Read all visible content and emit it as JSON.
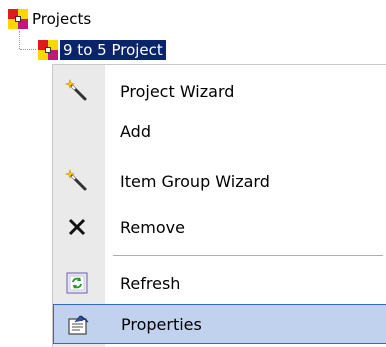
{
  "tree": {
    "root_label": "Projects",
    "child_label": "9 to 5 Project"
  },
  "menu": {
    "items": [
      {
        "label": "Project Wizard",
        "icon": "magic-wand-icon"
      },
      {
        "label": "Add",
        "icon": ""
      },
      {
        "label": "Item Group Wizard",
        "icon": "magic-wand-icon"
      },
      {
        "label": "Remove",
        "icon": "close-icon"
      },
      {
        "label": "Refresh",
        "icon": "refresh-icon"
      },
      {
        "label": "Properties",
        "icon": "properties-icon"
      }
    ]
  },
  "colors": {
    "selection": "#0a246a",
    "hover_fill": "#c1d2ee",
    "hover_border": "#316ac5"
  }
}
